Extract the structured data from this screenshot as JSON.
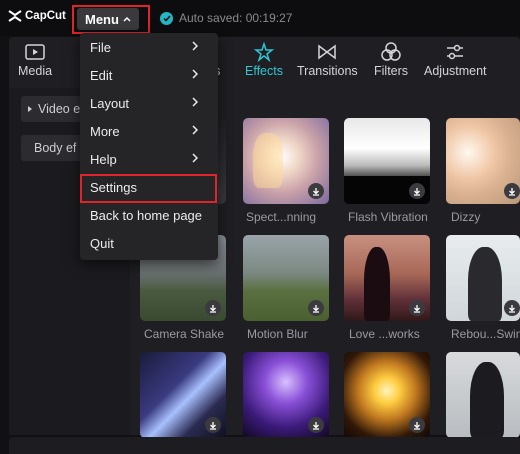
{
  "app": {
    "name": "CapCut"
  },
  "header": {
    "menu_label": "Menu",
    "autosave_text": "Auto saved: 00:19:27"
  },
  "toolbar": {
    "tabs": [
      {
        "label": "Media",
        "icon": "media-icon",
        "active": false
      },
      {
        "label": "rs",
        "icon": "stickers-icon",
        "active": false
      },
      {
        "label": "Effects",
        "icon": "effects-icon",
        "active": true
      },
      {
        "label": "Transitions",
        "icon": "transitions-icon",
        "active": false
      },
      {
        "label": "Filters",
        "icon": "filters-icon",
        "active": false
      },
      {
        "label": "Adjustment",
        "icon": "adjustment-icon",
        "active": false
      }
    ]
  },
  "sidebar": {
    "items": [
      {
        "label": "Video e"
      },
      {
        "label": "Body ef"
      }
    ]
  },
  "menu": {
    "items": [
      {
        "label": "File",
        "has_submenu": true
      },
      {
        "label": "Edit",
        "has_submenu": true
      },
      {
        "label": "Layout",
        "has_submenu": true
      },
      {
        "label": "More",
        "has_submenu": true
      },
      {
        "label": "Help",
        "has_submenu": true
      },
      {
        "label": "Settings",
        "has_submenu": false,
        "highlighted": true
      },
      {
        "label": "Back to home page",
        "has_submenu": false
      },
      {
        "label": "Quit",
        "has_submenu": false
      }
    ]
  },
  "effects": {
    "captions": [
      "g",
      "Spect...nning",
      "Flash Vibration",
      "Dizzy",
      "Camera Shake",
      "Motion Blur",
      "Love ...works",
      "Rebou...Swing"
    ]
  },
  "colors": {
    "accent": "#2fc6d3",
    "highlight_box": "#e0242c",
    "background": "#111114",
    "panel": "#1f1f23"
  }
}
